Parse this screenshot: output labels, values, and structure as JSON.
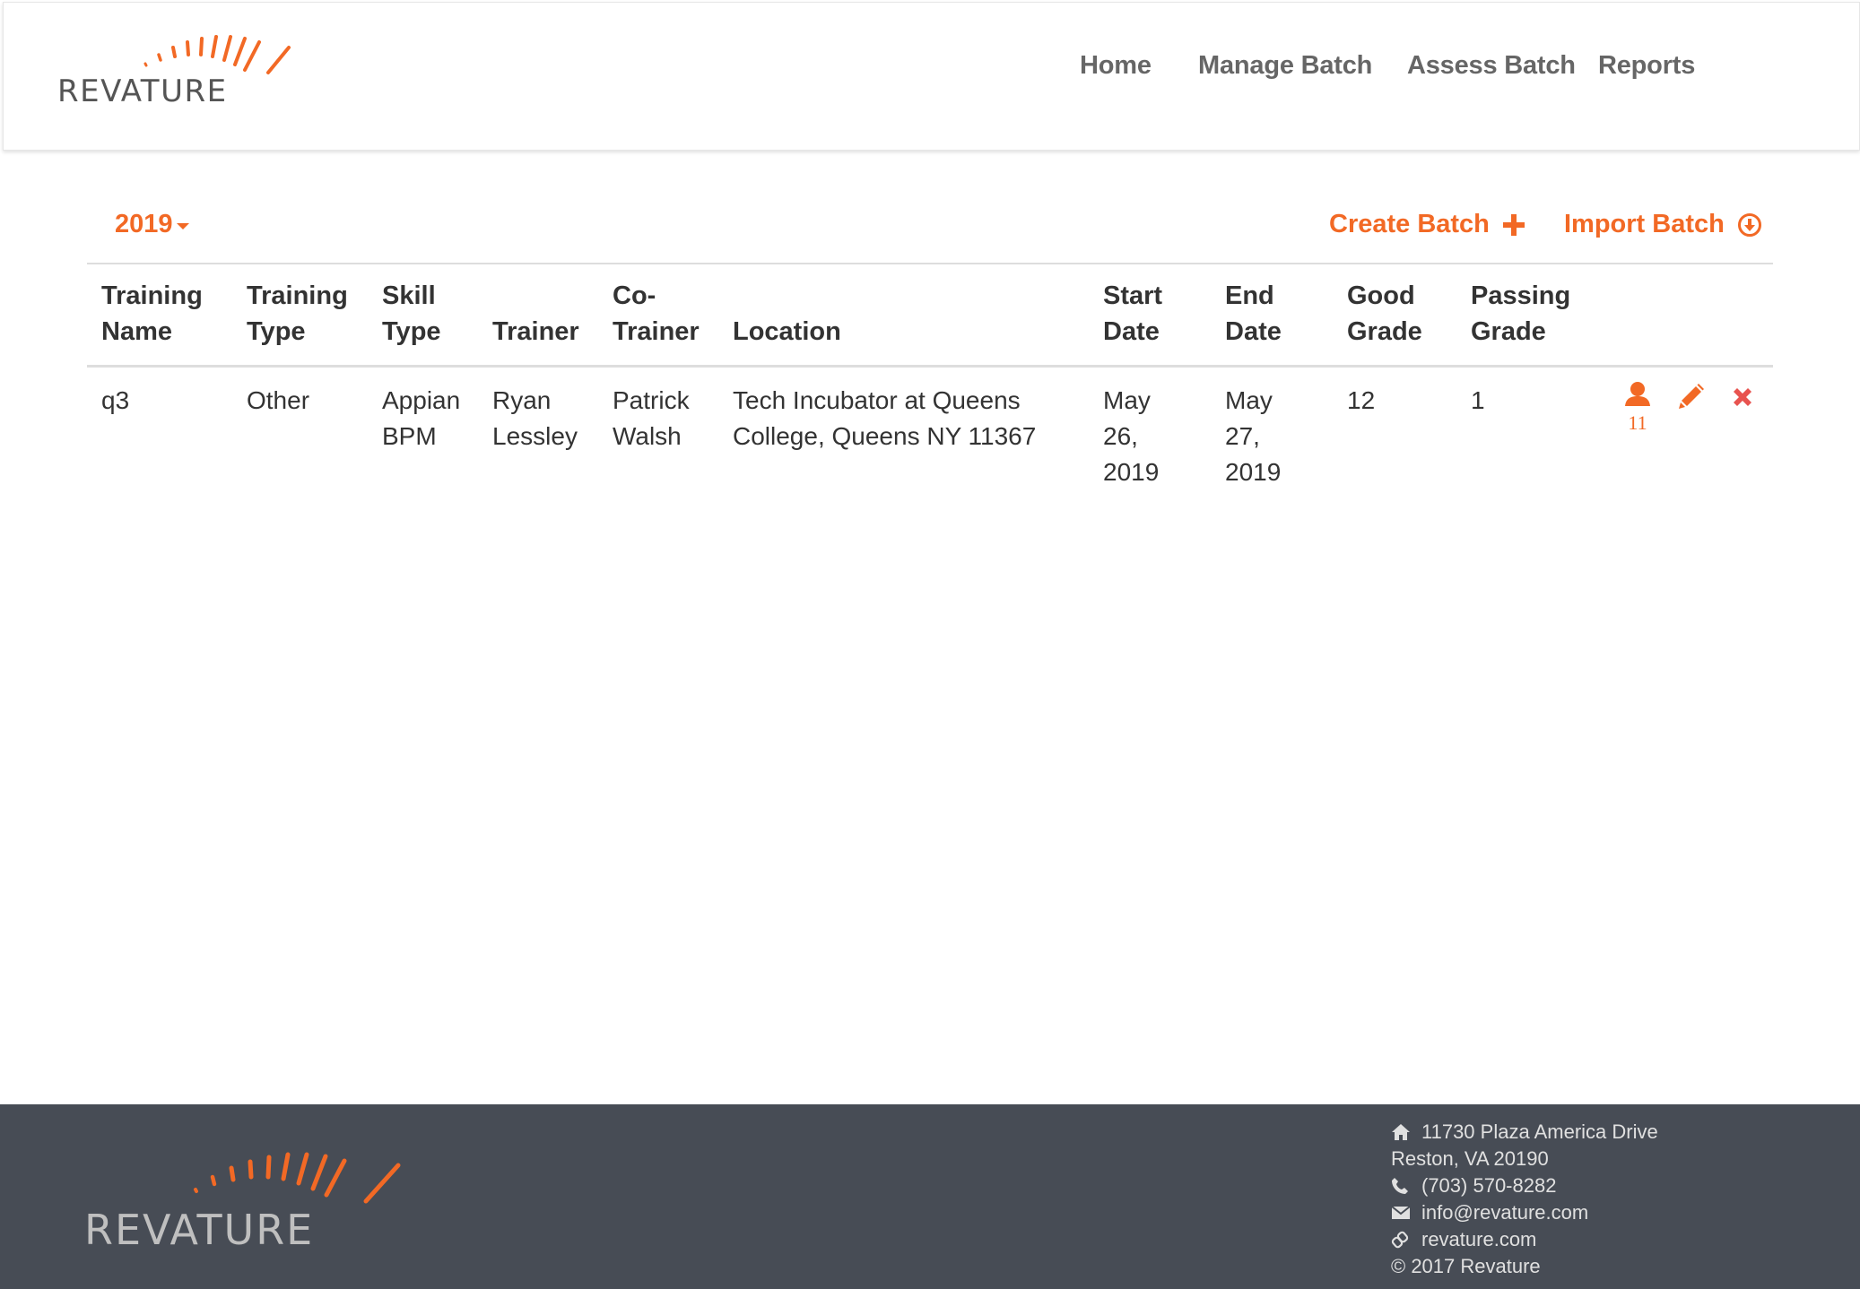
{
  "brand": {
    "logo_text": "REVATURE",
    "accent_color": "#f26925",
    "text_color": "#555555"
  },
  "nav": {
    "home": "Home",
    "manage_batch": "Manage Batch",
    "assess_batch": "Assess Batch",
    "reports": "Reports"
  },
  "toolbar": {
    "year": "2019",
    "create_batch": "Create Batch",
    "create_icon": "plus-icon",
    "import_batch": "Import Batch",
    "import_icon": "circle-download-icon"
  },
  "table": {
    "headers": {
      "training_name": [
        "Training",
        "Name"
      ],
      "training_type": [
        "Training",
        "Type"
      ],
      "skill_type": [
        "Skill",
        "Type"
      ],
      "trainer": [
        "Trainer"
      ],
      "co_trainer": [
        "Co-",
        "Trainer"
      ],
      "location": [
        "Location"
      ],
      "start_date": [
        "Start",
        "Date"
      ],
      "end_date": [
        "End",
        "Date"
      ],
      "good_grade": [
        "Good",
        "Grade"
      ],
      "passing_grade": [
        "Passing",
        "Grade"
      ]
    },
    "rows": [
      {
        "training_name": [
          "q3"
        ],
        "training_type": [
          "Other"
        ],
        "skill_type": [
          "Appian",
          "BPM"
        ],
        "trainer": [
          "Ryan",
          "Lessley"
        ],
        "co_trainer": [
          "Patrick",
          "Walsh"
        ],
        "location": [
          "Tech Incubator at Queens",
          "College, Queens NY 11367"
        ],
        "start_date": [
          "May",
          "26,",
          "2019"
        ],
        "end_date": [
          "May",
          "27,",
          "2019"
        ],
        "good_grade": [
          "12"
        ],
        "passing_grade": [
          "1"
        ],
        "trainee_count": "11",
        "trainee_icon": "user-icon",
        "edit_icon": "pencil-icon",
        "delete_icon": "close-icon",
        "delete_color": "#e8534f"
      }
    ]
  },
  "footer": {
    "address_line1": "11730 Plaza America Drive",
    "address_line2": "Reston, VA 20190",
    "phone": "(703) 570-8282",
    "email": "info@revature.com",
    "website": "revature.com",
    "copyright": "© 2017 Revature",
    "bg_color": "#474c55"
  }
}
